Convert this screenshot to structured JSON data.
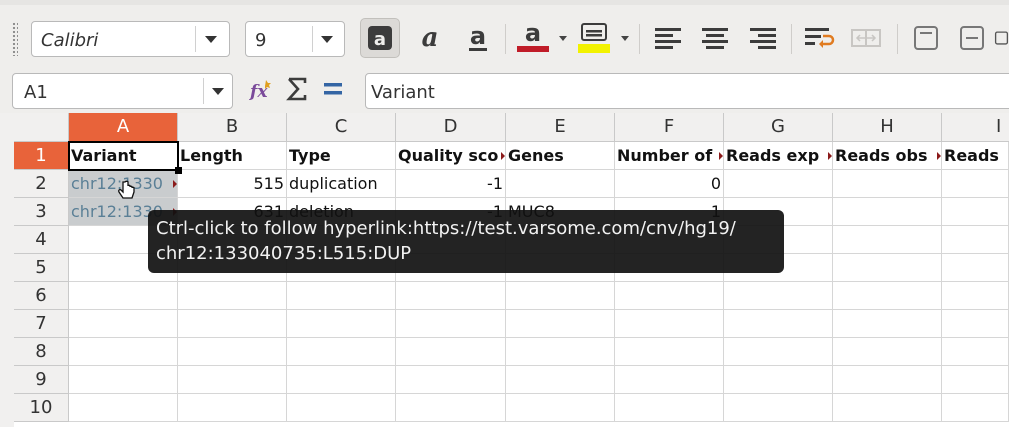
{
  "toolbar": {
    "font_name": "Calibri",
    "font_size": "9",
    "font_color": "#c01c28",
    "highlight_color": "#f2f200"
  },
  "formula_bar": {
    "cell_reference": "A1",
    "content": "Variant"
  },
  "sheet": {
    "columns": [
      "A",
      "B",
      "C",
      "D",
      "E",
      "F",
      "G",
      "H",
      "I"
    ],
    "rows": [
      "1",
      "2",
      "3",
      "4",
      "5",
      "6",
      "7",
      "8",
      "9",
      "10"
    ],
    "cells": {
      "row1": [
        "Variant",
        "Length",
        "Type",
        "Quality sco",
        "Genes",
        "Number of",
        "Reads exp",
        "Reads obs",
        "Reads"
      ],
      "row2": [
        "chr12:1330",
        "515",
        "duplication",
        "-1",
        "",
        "0",
        "",
        "",
        ""
      ],
      "row3": [
        "chr12:1330",
        "631",
        "deletion",
        "-1",
        "MUC8",
        "1",
        "",
        "",
        ""
      ]
    }
  },
  "tooltip": {
    "line1": "Ctrl-click to follow hyperlink:https://test.varsome.com/cnv/hg19/",
    "line2": "chr12:133040735:L515:DUP"
  },
  "colors": {
    "selected_header": "#e8633a",
    "link_text": "#5a7f96"
  }
}
